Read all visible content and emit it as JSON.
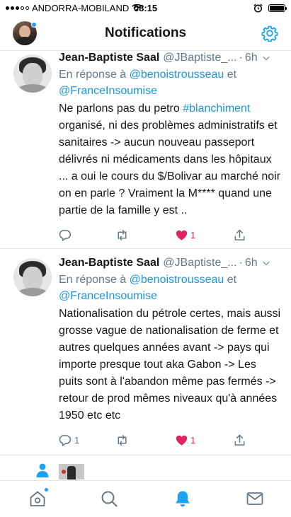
{
  "status_bar": {
    "carrier": "ANDORRA-MOBILAND",
    "time": "08:15"
  },
  "header": {
    "title": "Notifications"
  },
  "tweets": [
    {
      "author_name": "Jean-Baptiste Saal",
      "author_handle": "@JBaptiste_...",
      "separator": "·",
      "time": "6h",
      "reply_prefix": "En réponse à",
      "reply_to": [
        "@benoistrousseau",
        "@FranceInsoumise"
      ],
      "reply_joiner": "et",
      "text_before_hashtag": "Ne parlons pas du petro ",
      "hashtag": "#blanchiment",
      "text_after_hashtag": " organisé, ni des problèmes administratifs et sanitaires -> aucun nouveau passeport délivrés ni médicaments dans les hôpitaux ... a oui le cours du $/Bolivar au marché noir on en parle ? Vraiment la M**** quand une partie de la famille y est ..",
      "reply_count": "",
      "retweet_count": "",
      "like_count": "1",
      "liked": true
    },
    {
      "author_name": "Jean-Baptiste Saal",
      "author_handle": "@JBaptiste_...",
      "separator": "·",
      "time": "6h",
      "reply_prefix": "En réponse à",
      "reply_to": [
        "@benoistrousseau",
        "@FranceInsoumise"
      ],
      "reply_joiner": "et",
      "text": "Nationalisation du pétrole certes, mais aussi grosse vague de nationalisation de ferme et autres quelques années avant -> pays qui importe presque tout aka Gabon -> Les puits sont à l'abandon même pas fermés -> retour de prod mêmes niveaux qu'à années 1950 etc etc",
      "reply_count": "1",
      "retweet_count": "",
      "like_count": "1",
      "liked": true
    }
  ],
  "tab_bar": {
    "items": [
      "home-icon",
      "search-icon",
      "notifications-icon",
      "messages-icon"
    ],
    "active": "notifications-icon"
  },
  "colors": {
    "accent": "#1da1f2",
    "link": "#1b95e0",
    "like": "#e0245e",
    "muted": "#657786",
    "text": "#14171a",
    "divider": "#e1e8ed"
  }
}
